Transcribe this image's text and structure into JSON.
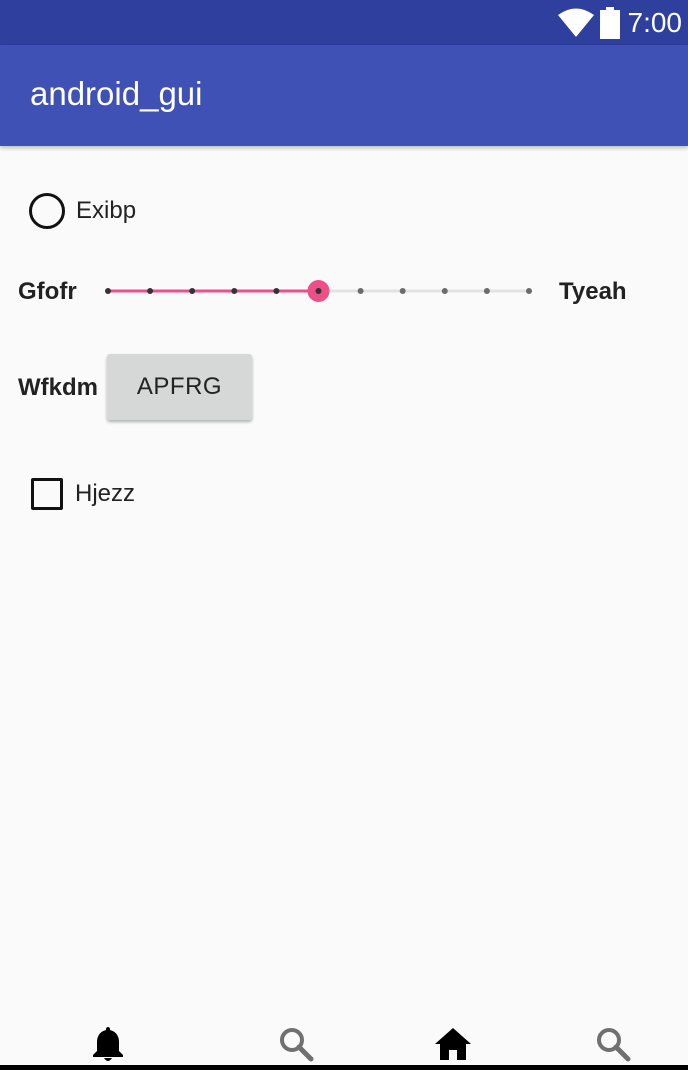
{
  "status_bar": {
    "time": "7:00",
    "icons": [
      "wifi-icon",
      "battery-icon"
    ]
  },
  "app_bar": {
    "title": "android_gui"
  },
  "radio": {
    "label": "Exibp",
    "checked": false
  },
  "slider": {
    "min_label": "Gfofr",
    "max_label": "Tyeah",
    "steps": 10,
    "value": 5,
    "accent_color": "#ef4f87"
  },
  "button_row": {
    "label": "Wfkdm",
    "button_text": "APFRG"
  },
  "checkbox": {
    "label": "Hjezz",
    "checked": false
  },
  "bottom_nav": {
    "items": [
      {
        "icon": "bell-icon",
        "active": true
      },
      {
        "icon": "search-icon",
        "active": false
      },
      {
        "icon": "home-icon",
        "active": true
      },
      {
        "icon": "search-icon",
        "active": false
      }
    ]
  },
  "colors": {
    "status_bar": "#2f3f9e",
    "app_bar": "#3f51b5",
    "background": "#fafafa",
    "button": "#d6d7d7"
  }
}
